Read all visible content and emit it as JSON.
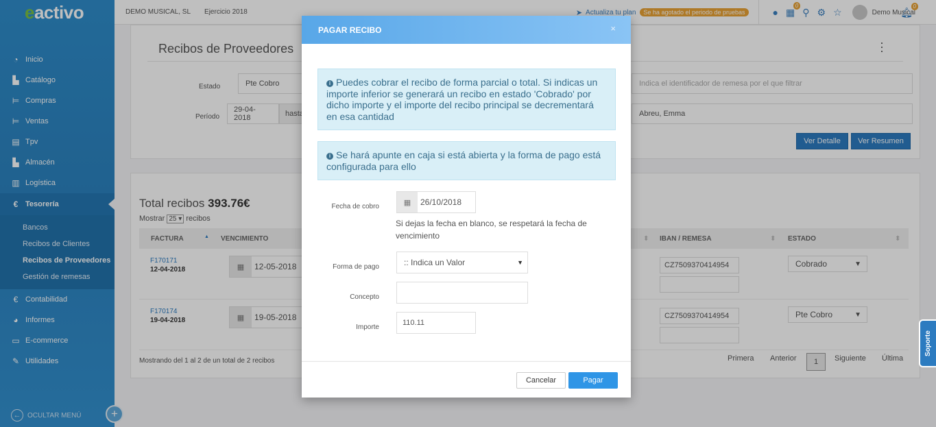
{
  "sidebar": {
    "logo_e": "e",
    "logo_rest": "activo",
    "items": [
      {
        "label": "Inicio",
        "icon": "dashboard-icon"
      },
      {
        "label": "Catálogo",
        "icon": "catalog-icon"
      },
      {
        "label": "Compras",
        "icon": "purchases-icon"
      },
      {
        "label": "Ventas",
        "icon": "sales-icon"
      },
      {
        "label": "Tpv",
        "icon": "pos-icon"
      },
      {
        "label": "Almacén",
        "icon": "warehouse-icon"
      },
      {
        "label": "Logística",
        "icon": "logistics-icon"
      },
      {
        "label": "Tesorería",
        "icon": "treasury-icon"
      }
    ],
    "submenu": [
      "Bancos",
      "Recibos de Clientes",
      "Recibos de Proveedores",
      "Gestión de remesas"
    ],
    "items_bottom": [
      {
        "label": "Contabilidad",
        "icon": "accounting-icon"
      },
      {
        "label": "Informes",
        "icon": "reports-icon"
      },
      {
        "label": "E-commerce",
        "icon": "ecommerce-icon"
      },
      {
        "label": "Utilidades",
        "icon": "utilities-icon"
      }
    ],
    "hide_menu": "OCULTAR MENÚ"
  },
  "topbar": {
    "company": "DEMO MUSICAL, SL",
    "year": "Ejercicio 2018",
    "plan": "Actualiza tu plan",
    "plan_badge": "Se ha agotado el periodo de pruebas",
    "calendar_count": "0",
    "user": "Demo Musical",
    "bell_count": "0"
  },
  "filters": {
    "title": "Recibos de Proveedores",
    "estado_label": "Estado",
    "estado_value": "Pte Cobro",
    "remesa_placeholder": "Indica el identificador de remesa por el que filtrar",
    "periodo_label": "Período",
    "periodo_from": "29-04-2018",
    "periodo_to_label": "hasta",
    "proveedor": "Abreu, Emma",
    "btn_detalle": "Ver Detalle",
    "btn_resumen": "Ver Resumen"
  },
  "list": {
    "total_label": "Total recibos",
    "total_value": "393.76€",
    "show_prefix": "Mostrar",
    "show_count": "25",
    "show_suffix": "recibos",
    "headers": [
      "FACTURA",
      "VENCIMIENTO",
      "IBAN / REMESA",
      "ESTADO"
    ],
    "rows": [
      {
        "factura": "F170171",
        "fecha": "12-04-2018",
        "vencimiento": "12-05-2018",
        "iban": "CZ7509370414954",
        "estado": "Cobrado"
      },
      {
        "factura": "F170174",
        "fecha": "19-04-2018",
        "vencimiento": "19-05-2018",
        "iban": "CZ7509370414954",
        "estado": "Pte Cobro"
      }
    ],
    "footer": "Mostrando del 1 al 2 de un total de 2 recibos",
    "pager": {
      "first": "Primera",
      "prev": "Anterior",
      "page": "1",
      "next": "Siguiente",
      "last": "Última"
    }
  },
  "modal": {
    "title": "PAGAR RECIBO",
    "close": "×",
    "alert1": "Puedes cobrar el recibo de forma parcial o total. Si indicas un importe inferior se generará un recibo en estado 'Cobrado' por dicho importe y el importe del recibo principal se decrementará en esa cantidad",
    "alert2": "Se hará apunte en caja si está abierta y la forma de pago está configurada para ello",
    "fecha_label": "Fecha de cobro",
    "fecha_value": "26/10/2018",
    "fecha_help": "Si dejas la fecha en blanco, se respetará la fecha de vencimiento",
    "forma_label": "Forma de pago",
    "forma_value": ":: Indica un Valor",
    "concepto_label": "Concepto",
    "concepto_value": "",
    "importe_label": "Importe",
    "importe_value": "110.11",
    "cancel": "Cancelar",
    "ok": "Pagar"
  },
  "support": "Soporte"
}
